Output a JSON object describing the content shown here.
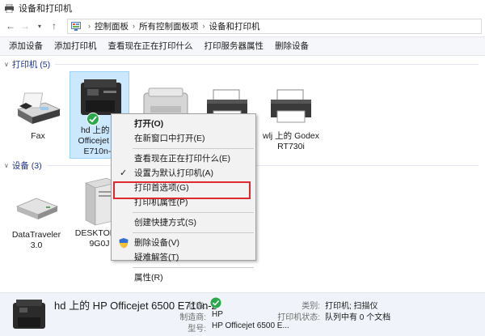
{
  "window": {
    "title": "设备和打印机"
  },
  "address_bar": {
    "crumbs": [
      "控制面板",
      "所有控制面板项",
      "设备和打印机"
    ]
  },
  "toolbar": {
    "buttons": [
      "添加设备",
      "添加打印机",
      "查看现在正在打印什么",
      "打印服务器属性",
      "删除设备"
    ]
  },
  "groups": {
    "printers": {
      "label": "打印机 (5)"
    },
    "devices": {
      "label": "设备 (3)"
    }
  },
  "printers": [
    {
      "label": "Fax",
      "icon": "fax-icon"
    },
    {
      "label": "hd 上的 HP Officejet 65 E710n-z",
      "line1": "hd 上的 H",
      "line2": "Officejet 65",
      "line3": "E710n-z",
      "icon": "printer-icon",
      "selected": true
    },
    {
      "label": "",
      "icon": "printer-icon"
    },
    {
      "label": "",
      "icon": "printer-icon"
    },
    {
      "label": "wlj 上的 Godex RT730i",
      "line1": "wlj 上的 Godex",
      "line2": "RT730i",
      "icon": "printer-icon"
    }
  ],
  "devices": [
    {
      "label": "DataTraveler 3.0",
      "line1": "DataTraveler",
      "line2": "3.0",
      "icon": "usb-drive-icon"
    },
    {
      "label": "DESKTOP-A 9G0J",
      "line1": "DESKTOP-A",
      "line2": "9G0J",
      "icon": "computer-tower-icon"
    }
  ],
  "context_menu": {
    "items": [
      {
        "label": "打开(O)",
        "bold": true
      },
      {
        "label": "在新窗口中打开(E)"
      },
      {
        "divider": true
      },
      {
        "label": "查看现在正在打印什么(E)"
      },
      {
        "label": "设置为默认打印机(A)",
        "checked": true
      },
      {
        "label": "打印首选项(G)"
      },
      {
        "label": "打印机属性(P)",
        "highlighted": true
      },
      {
        "divider": true
      },
      {
        "label": "创建快捷方式(S)"
      },
      {
        "divider": true
      },
      {
        "label": "删除设备(V)",
        "icon": "shield-icon"
      },
      {
        "label": "疑难解答(T)"
      },
      {
        "divider": true
      },
      {
        "label": "属性(R)"
      }
    ]
  },
  "details": {
    "name": "hd 上的 HP Officejet 6500 E710n-z",
    "status_label": "状态:",
    "status_value": "",
    "manufacturer_label": "制造商:",
    "manufacturer_value": "HP",
    "model_label": "型号:",
    "model_value": "HP Officejet 6500 E...",
    "category_label": "类别:",
    "category_value": "打印机; 扫描仪",
    "printer_status_label": "打印机状态:",
    "printer_status_value": "队列中有 0 个文档"
  },
  "colors": {
    "highlight_border": "#e0282e",
    "selected_bg": "#cce8ff",
    "group_header": "#1e3287",
    "default_check": "#2aa84a"
  }
}
